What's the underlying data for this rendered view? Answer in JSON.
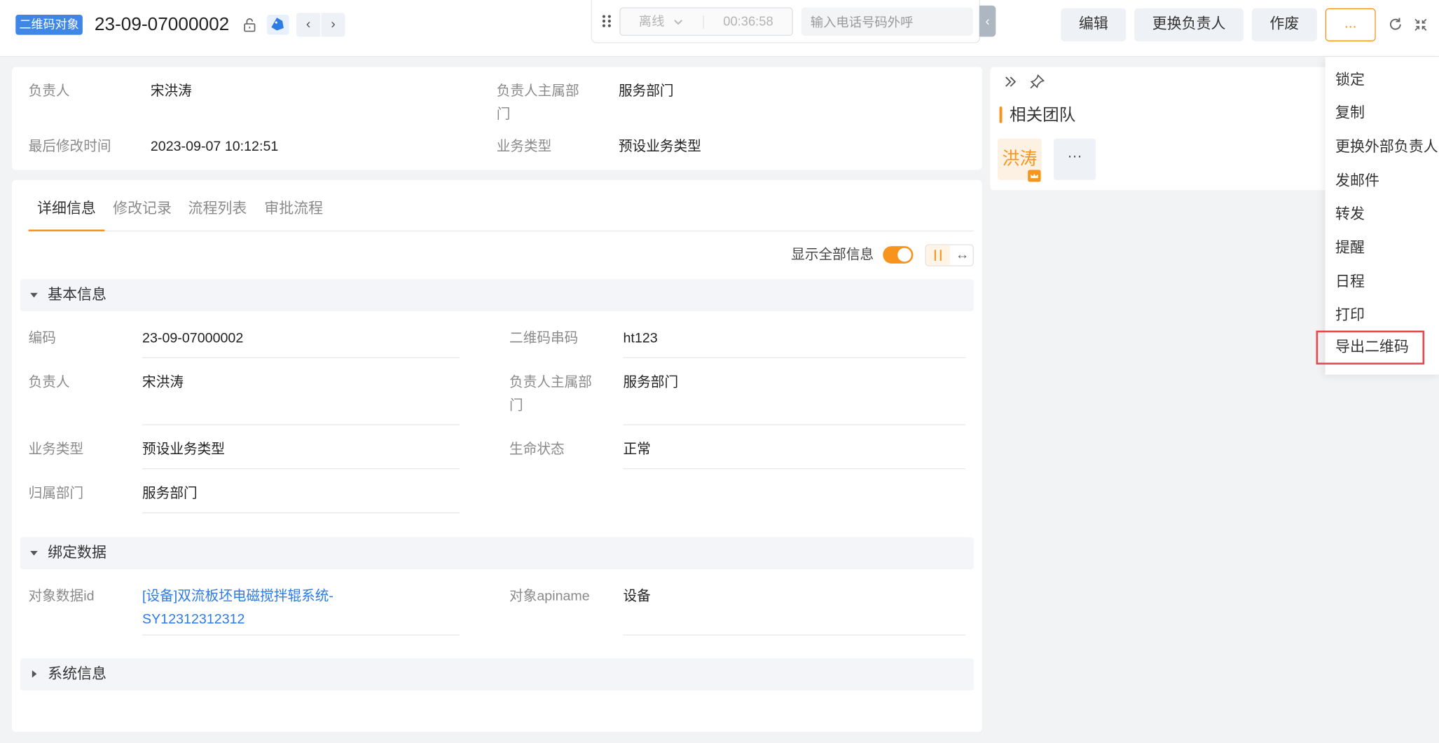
{
  "header": {
    "object_tag": "二维码对象",
    "record_title": "23-09-07000002",
    "prev_symbol": "‹",
    "next_symbol": "›"
  },
  "call_bar": {
    "status": "离线",
    "timer": "00:36:58",
    "phone_placeholder": "输入电话号码外呼",
    "collapse_symbol": "‹"
  },
  "toolbar": {
    "edit": "编辑",
    "change_owner": "更换负责人",
    "void": "作废",
    "more": "..."
  },
  "summary": {
    "owner_label": "负责人",
    "owner_value": "宋洪涛",
    "dept_label_1": "负责人主属部",
    "dept_label_2": "门",
    "dept_value": "服务部门",
    "modified_label": "最后修改时间",
    "modified_value": "2023-09-07 10:12:51",
    "biztype_label": "业务类型",
    "biztype_value": "预设业务类型"
  },
  "tabs": [
    "详细信息",
    "修改记录",
    "流程列表",
    "审批流程"
  ],
  "detail": {
    "show_all_label": "显示全部信息",
    "layout_alt_symbol": "↔",
    "sections": {
      "basic": "基本信息",
      "binding": "绑定数据",
      "system": "系统信息"
    },
    "basic": {
      "code_label": "编码",
      "code_value": "23-09-07000002",
      "qr_label": "二维码串码",
      "qr_value": "ht123",
      "owner_label": "负责人",
      "owner_value": "宋洪涛",
      "dept_label_1": "负责人主属部",
      "dept_label_2": "门",
      "dept_value": "服务部门",
      "biztype_label": "业务类型",
      "biztype_value": "预设业务类型",
      "life_label": "生命状态",
      "life_value": "正常",
      "belong_label": "归属部门",
      "belong_value": "服务部门"
    },
    "binding": {
      "objid_label": "对象数据id",
      "objid_value_1": "[设备]双流板坯电磁搅拌辊系统-",
      "objid_value_2": "SY12312312312",
      "api_label": "对象apiname",
      "api_value": "设备"
    }
  },
  "team": {
    "title": "相关团队",
    "member": "洪涛",
    "more": "···"
  },
  "menu": [
    "锁定",
    "复制",
    "更换外部负责人",
    "发邮件",
    "转发",
    "提醒",
    "日程",
    "打印",
    "导出二维码"
  ],
  "colors": {
    "accent": "#f7941d",
    "tag_blue": "#3f87e6",
    "link": "#2d7be5",
    "highlight_border": "#e5484d"
  }
}
